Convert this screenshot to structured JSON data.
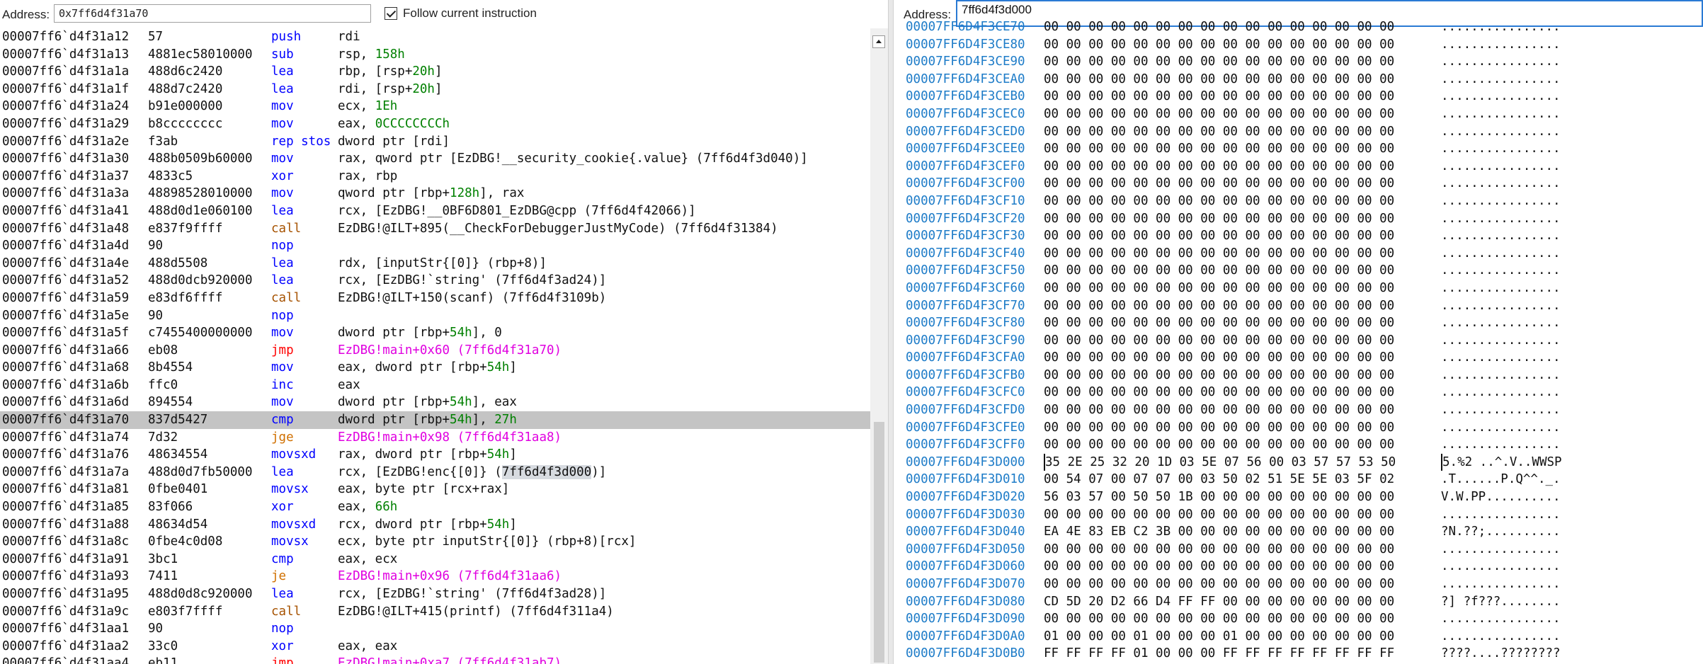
{
  "disasm": {
    "address_label": "Address:",
    "address_value": "0x7ff6d4f31a70",
    "follow_label": "Follow current instruction",
    "lines": [
      {
        "addr": "00007ff6`d4f31a12",
        "bytes": "57",
        "mn": "push",
        "mc": "blue",
        "ops": [
          {
            "t": "rdi"
          }
        ]
      },
      {
        "addr": "00007ff6`d4f31a13",
        "bytes": "4881ec58010000",
        "mn": "sub",
        "mc": "blue",
        "ops": [
          {
            "t": "rsp, "
          },
          {
            "t": "158h",
            "n": true
          }
        ]
      },
      {
        "addr": "00007ff6`d4f31a1a",
        "bytes": "488d6c2420",
        "mn": "lea",
        "mc": "blue",
        "ops": [
          {
            "t": "rbp, [rsp+"
          },
          {
            "t": "20h",
            "n": true
          },
          {
            "t": "]"
          }
        ]
      },
      {
        "addr": "00007ff6`d4f31a1f",
        "bytes": "488d7c2420",
        "mn": "lea",
        "mc": "blue",
        "ops": [
          {
            "t": "rdi, [rsp+"
          },
          {
            "t": "20h",
            "n": true
          },
          {
            "t": "]"
          }
        ]
      },
      {
        "addr": "00007ff6`d4f31a24",
        "bytes": "b91e000000",
        "mn": "mov",
        "mc": "blue",
        "ops": [
          {
            "t": "ecx, "
          },
          {
            "t": "1Eh",
            "n": true
          }
        ]
      },
      {
        "addr": "00007ff6`d4f31a29",
        "bytes": "b8cccccccc",
        "mn": "mov",
        "mc": "blue",
        "ops": [
          {
            "t": "eax, "
          },
          {
            "t": "0CCCCCCCCh",
            "n": true
          }
        ]
      },
      {
        "addr": "00007ff6`d4f31a2e",
        "bytes": "f3ab",
        "mn": "rep stos",
        "mc": "blue",
        "ops": [
          {
            "t": "dword ptr [rdi]"
          }
        ]
      },
      {
        "addr": "00007ff6`d4f31a30",
        "bytes": "488b0509b60000",
        "mn": "mov",
        "mc": "blue",
        "ops": [
          {
            "t": "rax, qword ptr [EzDBG!__security_cookie{.value} (7ff6d4f3d040)]"
          }
        ]
      },
      {
        "addr": "00007ff6`d4f31a37",
        "bytes": "4833c5",
        "mn": "xor",
        "mc": "blue",
        "ops": [
          {
            "t": "rax, rbp"
          }
        ]
      },
      {
        "addr": "00007ff6`d4f31a3a",
        "bytes": "48898528010000",
        "mn": "mov",
        "mc": "blue",
        "ops": [
          {
            "t": "qword ptr [rbp+"
          },
          {
            "t": "128h",
            "n": true
          },
          {
            "t": "], rax"
          }
        ]
      },
      {
        "addr": "00007ff6`d4f31a41",
        "bytes": "488d0d1e060100",
        "mn": "lea",
        "mc": "blue",
        "ops": [
          {
            "t": "rcx, [EzDBG!__0BF6D801_EzDBG@cpp (7ff6d4f42066)]"
          }
        ]
      },
      {
        "addr": "00007ff6`d4f31a48",
        "bytes": "e837f9ffff",
        "mn": "call",
        "mc": "brown",
        "ops": [
          {
            "t": "EzDBG!@ILT+895(__CheckForDebuggerJustMyCode) (7ff6d4f31384)"
          }
        ]
      },
      {
        "addr": "00007ff6`d4f31a4d",
        "bytes": "90",
        "mn": "nop",
        "mc": "blue",
        "ops": []
      },
      {
        "addr": "00007ff6`d4f31a4e",
        "bytes": "488d5508",
        "mn": "lea",
        "mc": "blue",
        "ops": [
          {
            "t": "rdx, [inputStr{[0]} (rbp+8)]"
          }
        ]
      },
      {
        "addr": "00007ff6`d4f31a52",
        "bytes": "488d0dcb920000",
        "mn": "lea",
        "mc": "blue",
        "ops": [
          {
            "t": "rcx, [EzDBG!`string' (7ff6d4f3ad24)]"
          }
        ]
      },
      {
        "addr": "00007ff6`d4f31a59",
        "bytes": "e83df6ffff",
        "mn": "call",
        "mc": "brown",
        "ops": [
          {
            "t": "EzDBG!@ILT+150(scanf) (7ff6d4f3109b)"
          }
        ]
      },
      {
        "addr": "00007ff6`d4f31a5e",
        "bytes": "90",
        "mn": "nop",
        "mc": "blue",
        "ops": []
      },
      {
        "addr": "00007ff6`d4f31a5f",
        "bytes": "c7455400000000",
        "mn": "mov",
        "mc": "blue",
        "ops": [
          {
            "t": "dword ptr [rbp+"
          },
          {
            "t": "54h",
            "n": true
          },
          {
            "t": "], 0"
          }
        ]
      },
      {
        "addr": "00007ff6`d4f31a66",
        "bytes": "eb08",
        "mn": "jmp",
        "mc": "red",
        "ops": [
          {
            "t": "EzDBG!main+0x60 (7ff6d4f31a70)",
            "mag": true
          }
        ]
      },
      {
        "addr": "00007ff6`d4f31a68",
        "bytes": "8b4554",
        "mn": "mov",
        "mc": "blue",
        "ops": [
          {
            "t": "eax, dword ptr [rbp+"
          },
          {
            "t": "54h",
            "n": true
          },
          {
            "t": "]"
          }
        ]
      },
      {
        "addr": "00007ff6`d4f31a6b",
        "bytes": "ffc0",
        "mn": "inc",
        "mc": "blue",
        "ops": [
          {
            "t": "eax"
          }
        ]
      },
      {
        "addr": "00007ff6`d4f31a6d",
        "bytes": "894554",
        "mn": "mov",
        "mc": "blue",
        "ops": [
          {
            "t": "dword ptr [rbp+"
          },
          {
            "t": "54h",
            "n": true
          },
          {
            "t": "], eax"
          }
        ]
      },
      {
        "addr": "00007ff6`d4f31a70",
        "bytes": "837d5427",
        "mn": "cmp",
        "mc": "blue",
        "cur": true,
        "ops": [
          {
            "t": "dword ptr [rbp+"
          },
          {
            "t": "54h",
            "n": true
          },
          {
            "t": "], "
          },
          {
            "t": "27h",
            "n": true
          }
        ]
      },
      {
        "addr": "00007ff6`d4f31a74",
        "bytes": "7d32",
        "mn": "jge",
        "mc": "orange",
        "ops": [
          {
            "t": "EzDBG!main+0x98 (7ff6d4f31aa8)",
            "mag": true
          }
        ]
      },
      {
        "addr": "00007ff6`d4f31a76",
        "bytes": "48634554",
        "mn": "movsxd",
        "mc": "blue",
        "ops": [
          {
            "t": "rax, dword ptr [rbp+"
          },
          {
            "t": "54h",
            "n": true
          },
          {
            "t": "]"
          }
        ]
      },
      {
        "addr": "00007ff6`d4f31a7a",
        "bytes": "488d0d7fb50000",
        "mn": "lea",
        "mc": "blue",
        "ops": [
          {
            "t": "rcx, [EzDBG!enc{[0]} ("
          },
          {
            "t": "7ff6d4f3d000",
            "hl": true
          },
          {
            "t": ")]"
          }
        ]
      },
      {
        "addr": "00007ff6`d4f31a81",
        "bytes": "0fbe0401",
        "mn": "movsx",
        "mc": "blue",
        "ops": [
          {
            "t": "eax, byte ptr [rcx+rax]"
          }
        ]
      },
      {
        "addr": "00007ff6`d4f31a85",
        "bytes": "83f066",
        "mn": "xor",
        "mc": "blue",
        "ops": [
          {
            "t": "eax, "
          },
          {
            "t": "66h",
            "n": true
          }
        ]
      },
      {
        "addr": "00007ff6`d4f31a88",
        "bytes": "48634d54",
        "mn": "movsxd",
        "mc": "blue",
        "ops": [
          {
            "t": "rcx, dword ptr [rbp+"
          },
          {
            "t": "54h",
            "n": true
          },
          {
            "t": "]"
          }
        ]
      },
      {
        "addr": "00007ff6`d4f31a8c",
        "bytes": "0fbe4c0d08",
        "mn": "movsx",
        "mc": "blue",
        "ops": [
          {
            "t": "ecx, byte ptr inputStr{[0]} (rbp+8)[rcx]"
          }
        ]
      },
      {
        "addr": "00007ff6`d4f31a91",
        "bytes": "3bc1",
        "mn": "cmp",
        "mc": "blue",
        "ops": [
          {
            "t": "eax, ecx"
          }
        ]
      },
      {
        "addr": "00007ff6`d4f31a93",
        "bytes": "7411",
        "mn": "je",
        "mc": "orange",
        "ops": [
          {
            "t": "EzDBG!main+0x96 (7ff6d4f31aa6)",
            "mag": true
          }
        ]
      },
      {
        "addr": "00007ff6`d4f31a95",
        "bytes": "488d0d8c920000",
        "mn": "lea",
        "mc": "blue",
        "ops": [
          {
            "t": "rcx, [EzDBG!`string' (7ff6d4f3ad28)]"
          }
        ]
      },
      {
        "addr": "00007ff6`d4f31a9c",
        "bytes": "e803f7ffff",
        "mn": "call",
        "mc": "brown",
        "ops": [
          {
            "t": "EzDBG!@ILT+415(printf) (7ff6d4f311a4)"
          }
        ]
      },
      {
        "addr": "00007ff6`d4f31aa1",
        "bytes": "90",
        "mn": "nop",
        "mc": "blue",
        "ops": []
      },
      {
        "addr": "00007ff6`d4f31aa2",
        "bytes": "33c0",
        "mn": "xor",
        "mc": "blue",
        "ops": [
          {
            "t": "eax, eax"
          }
        ]
      },
      {
        "addr": "00007ff6`d4f31aa4",
        "bytes": "eb11",
        "mn": "jmp",
        "mc": "red",
        "ops": [
          {
            "t": "EzDBG!main+0xa7 (7ff6d4f31ab7)",
            "mag": true
          }
        ]
      }
    ]
  },
  "memory": {
    "address_label": "Address:",
    "address_value": "7ff6d4f3d000",
    "lines": [
      {
        "addr": "00007FF6D4F3CE70",
        "hex": "00 00 00 00 00 00 00 00 00 00 00 00 00 00 00 00",
        "ascii": "................"
      },
      {
        "addr": "00007FF6D4F3CE80",
        "hex": "00 00 00 00 00 00 00 00 00 00 00 00 00 00 00 00",
        "ascii": "................"
      },
      {
        "addr": "00007FF6D4F3CE90",
        "hex": "00 00 00 00 00 00 00 00 00 00 00 00 00 00 00 00",
        "ascii": "................"
      },
      {
        "addr": "00007FF6D4F3CEA0",
        "hex": "00 00 00 00 00 00 00 00 00 00 00 00 00 00 00 00",
        "ascii": "................"
      },
      {
        "addr": "00007FF6D4F3CEB0",
        "hex": "00 00 00 00 00 00 00 00 00 00 00 00 00 00 00 00",
        "ascii": "................"
      },
      {
        "addr": "00007FF6D4F3CEC0",
        "hex": "00 00 00 00 00 00 00 00 00 00 00 00 00 00 00 00",
        "ascii": "................"
      },
      {
        "addr": "00007FF6D4F3CED0",
        "hex": "00 00 00 00 00 00 00 00 00 00 00 00 00 00 00 00",
        "ascii": "................"
      },
      {
        "addr": "00007FF6D4F3CEE0",
        "hex": "00 00 00 00 00 00 00 00 00 00 00 00 00 00 00 00",
        "ascii": "................"
      },
      {
        "addr": "00007FF6D4F3CEF0",
        "hex": "00 00 00 00 00 00 00 00 00 00 00 00 00 00 00 00",
        "ascii": "................"
      },
      {
        "addr": "00007FF6D4F3CF00",
        "hex": "00 00 00 00 00 00 00 00 00 00 00 00 00 00 00 00",
        "ascii": "................"
      },
      {
        "addr": "00007FF6D4F3CF10",
        "hex": "00 00 00 00 00 00 00 00 00 00 00 00 00 00 00 00",
        "ascii": "................"
      },
      {
        "addr": "00007FF6D4F3CF20",
        "hex": "00 00 00 00 00 00 00 00 00 00 00 00 00 00 00 00",
        "ascii": "................"
      },
      {
        "addr": "00007FF6D4F3CF30",
        "hex": "00 00 00 00 00 00 00 00 00 00 00 00 00 00 00 00",
        "ascii": "................"
      },
      {
        "addr": "00007FF6D4F3CF40",
        "hex": "00 00 00 00 00 00 00 00 00 00 00 00 00 00 00 00",
        "ascii": "................"
      },
      {
        "addr": "00007FF6D4F3CF50",
        "hex": "00 00 00 00 00 00 00 00 00 00 00 00 00 00 00 00",
        "ascii": "................"
      },
      {
        "addr": "00007FF6D4F3CF60",
        "hex": "00 00 00 00 00 00 00 00 00 00 00 00 00 00 00 00",
        "ascii": "................"
      },
      {
        "addr": "00007FF6D4F3CF70",
        "hex": "00 00 00 00 00 00 00 00 00 00 00 00 00 00 00 00",
        "ascii": "................"
      },
      {
        "addr": "00007FF6D4F3CF80",
        "hex": "00 00 00 00 00 00 00 00 00 00 00 00 00 00 00 00",
        "ascii": "................"
      },
      {
        "addr": "00007FF6D4F3CF90",
        "hex": "00 00 00 00 00 00 00 00 00 00 00 00 00 00 00 00",
        "ascii": "................"
      },
      {
        "addr": "00007FF6D4F3CFA0",
        "hex": "00 00 00 00 00 00 00 00 00 00 00 00 00 00 00 00",
        "ascii": "................"
      },
      {
        "addr": "00007FF6D4F3CFB0",
        "hex": "00 00 00 00 00 00 00 00 00 00 00 00 00 00 00 00",
        "ascii": "................"
      },
      {
        "addr": "00007FF6D4F3CFC0",
        "hex": "00 00 00 00 00 00 00 00 00 00 00 00 00 00 00 00",
        "ascii": "................"
      },
      {
        "addr": "00007FF6D4F3CFD0",
        "hex": "00 00 00 00 00 00 00 00 00 00 00 00 00 00 00 00",
        "ascii": "................"
      },
      {
        "addr": "00007FF6D4F3CFE0",
        "hex": "00 00 00 00 00 00 00 00 00 00 00 00 00 00 00 00",
        "ascii": "................"
      },
      {
        "addr": "00007FF6D4F3CFF0",
        "hex": "00 00 00 00 00 00 00 00 00 00 00 00 00 00 00 00",
        "ascii": "................"
      },
      {
        "addr": "00007FF6D4F3D000",
        "hex": "35 2E 25 32 20 1D 03 5E 07 56 00 03 57 57 53 50",
        "ascii": "5.%2 ..^.V..WWSP",
        "cur": true
      },
      {
        "addr": "00007FF6D4F3D010",
        "hex": "00 54 07 00 07 07 00 03 50 02 51 5E 5E 03 5F 02",
        "ascii": ".T......P.Q^^._."
      },
      {
        "addr": "00007FF6D4F3D020",
        "hex": "56 03 57 00 50 50 1B 00 00 00 00 00 00 00 00 00",
        "ascii": "V.W.PP.........."
      },
      {
        "addr": "00007FF6D4F3D030",
        "hex": "00 00 00 00 00 00 00 00 00 00 00 00 00 00 00 00",
        "ascii": "................"
      },
      {
        "addr": "00007FF6D4F3D040",
        "hex": "EA 4E 83 EB C2 3B 00 00 00 00 00 00 00 00 00 00",
        "ascii": "?N.??;.........."
      },
      {
        "addr": "00007FF6D4F3D050",
        "hex": "00 00 00 00 00 00 00 00 00 00 00 00 00 00 00 00",
        "ascii": "................"
      },
      {
        "addr": "00007FF6D4F3D060",
        "hex": "00 00 00 00 00 00 00 00 00 00 00 00 00 00 00 00",
        "ascii": "................"
      },
      {
        "addr": "00007FF6D4F3D070",
        "hex": "00 00 00 00 00 00 00 00 00 00 00 00 00 00 00 00",
        "ascii": "................"
      },
      {
        "addr": "00007FF6D4F3D080",
        "hex": "CD 5D 20 D2 66 D4 FF FF 00 00 00 00 00 00 00 00",
        "ascii": "?] ?f???........"
      },
      {
        "addr": "00007FF6D4F3D090",
        "hex": "00 00 00 00 00 00 00 00 00 00 00 00 00 00 00 00",
        "ascii": "................"
      },
      {
        "addr": "00007FF6D4F3D0A0",
        "hex": "01 00 00 00 01 00 00 00 01 00 00 00 00 00 00 00",
        "ascii": "................"
      },
      {
        "addr": "00007FF6D4F3D0B0",
        "hex": "FF FF FF FF 01 00 00 00 FF FF FF FF FF FF FF FF",
        "ascii": "????....????????"
      }
    ]
  },
  "colors": {
    "mnemonic_blue": "#0000ff",
    "call_brown": "#a65200",
    "jcc_orange": "#d07000",
    "jmp_red": "#ff0000",
    "label_magenta": "#e000e0",
    "immediate_green": "#008000",
    "mem_addr_blue": "#1e7cc8",
    "current_line": "#c4c4c4"
  }
}
